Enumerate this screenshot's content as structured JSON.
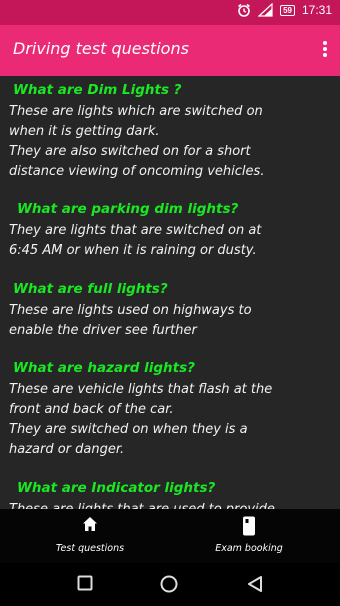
{
  "status": {
    "time": "17:31",
    "battery": "59"
  },
  "app": {
    "title": "Driving test questions"
  },
  "qa": [
    {
      "q": "What are Dim Lights ?",
      "lines": [
        " These are lights which are switched on",
        "when it is getting dark.",
        " They are also switched on for a short",
        "distance viewing of oncoming vehicles."
      ]
    },
    {
      "q": "What are parking dim lights?",
      "lines": [
        " They are lights that are switched on at",
        "6:45 AM or when it is raining or dusty."
      ]
    },
    {
      "q": "What are full lights?",
      "lines": [
        " These are lights used on highways to",
        "enable the driver see further"
      ]
    },
    {
      "q": "What are hazard lights?",
      "lines": [
        " These are vehicle lights that flash at the",
        "front and back of the car.",
        " They are switched on when they is a",
        "hazard or danger."
      ]
    },
    {
      "q": "What are Indicator lights?",
      "lines": [
        " These are lights that are used to provide"
      ]
    }
  ],
  "bottom_nav": {
    "tab1": "Test questions",
    "tab2": "Exam booking"
  },
  "icons": [
    "alarm-icon",
    "signal-icon",
    "battery-icon",
    "overflow-menu-icon",
    "home-icon",
    "phone-icon",
    "back-icon",
    "home-circle-icon",
    "recents-icon"
  ]
}
